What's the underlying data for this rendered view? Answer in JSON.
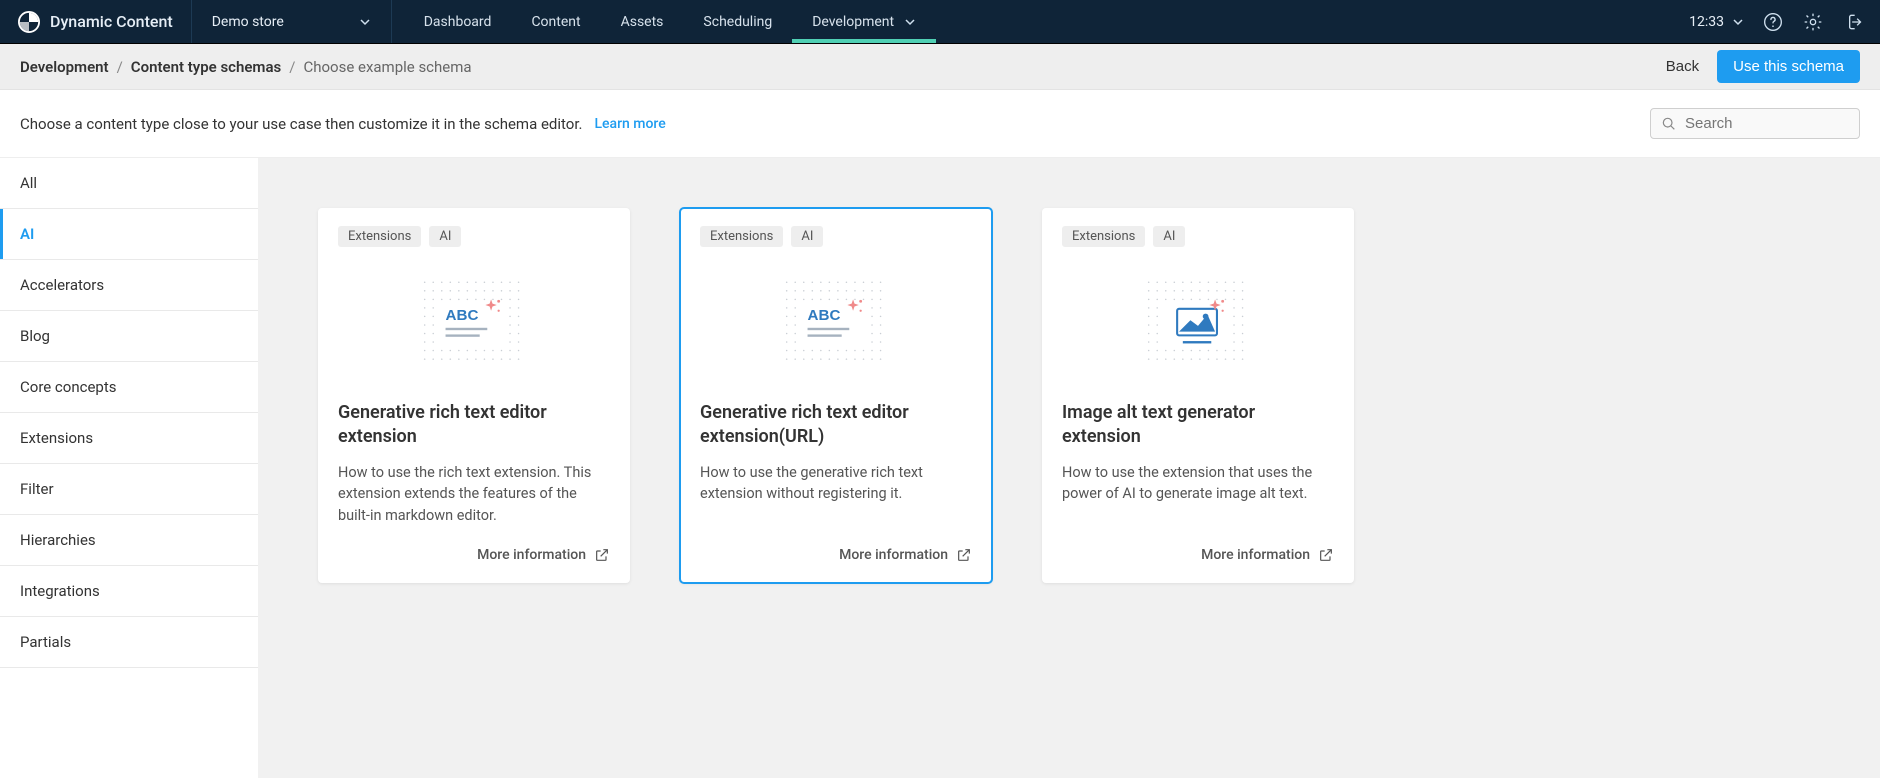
{
  "brand": "Dynamic Content",
  "hub": "Demo store",
  "nav": {
    "items": [
      "Dashboard",
      "Content",
      "Assets",
      "Scheduling",
      "Development"
    ],
    "active": 4
  },
  "clock": "12:33",
  "breadcrumb": {
    "items": [
      "Development",
      "Content type schemas"
    ],
    "current": "Choose example schema"
  },
  "actions": {
    "back": "Back",
    "use": "Use this schema"
  },
  "info": {
    "text": "Choose a content type close to your use case then customize it in the schema editor.",
    "learn": "Learn more"
  },
  "search": {
    "placeholder": "Search"
  },
  "sidebar": {
    "items": [
      "All",
      "AI",
      "Accelerators",
      "Blog",
      "Core concepts",
      "Extensions",
      "Filter",
      "Hierarchies",
      "Integrations",
      "Partials"
    ],
    "selectedIndex": 1
  },
  "cards": [
    {
      "tags": [
        "Extensions",
        "AI"
      ],
      "title": "Generative rich text editor extension",
      "desc": "How to use the rich text extension. This extension extends the features of the built-in markdown editor.",
      "more": "More information",
      "illustration": "abc",
      "selected": false
    },
    {
      "tags": [
        "Extensions",
        "AI"
      ],
      "title": "Generative rich text editor extension(URL)",
      "desc": "How to use the generative rich text extension without registering it.",
      "more": "More information",
      "illustration": "abc",
      "selected": true
    },
    {
      "tags": [
        "Extensions",
        "AI"
      ],
      "title": "Image alt text generator extension",
      "desc": "How to use the extension that uses the power of AI to generate image alt text.",
      "more": "More information",
      "illustration": "image",
      "selected": false
    }
  ]
}
